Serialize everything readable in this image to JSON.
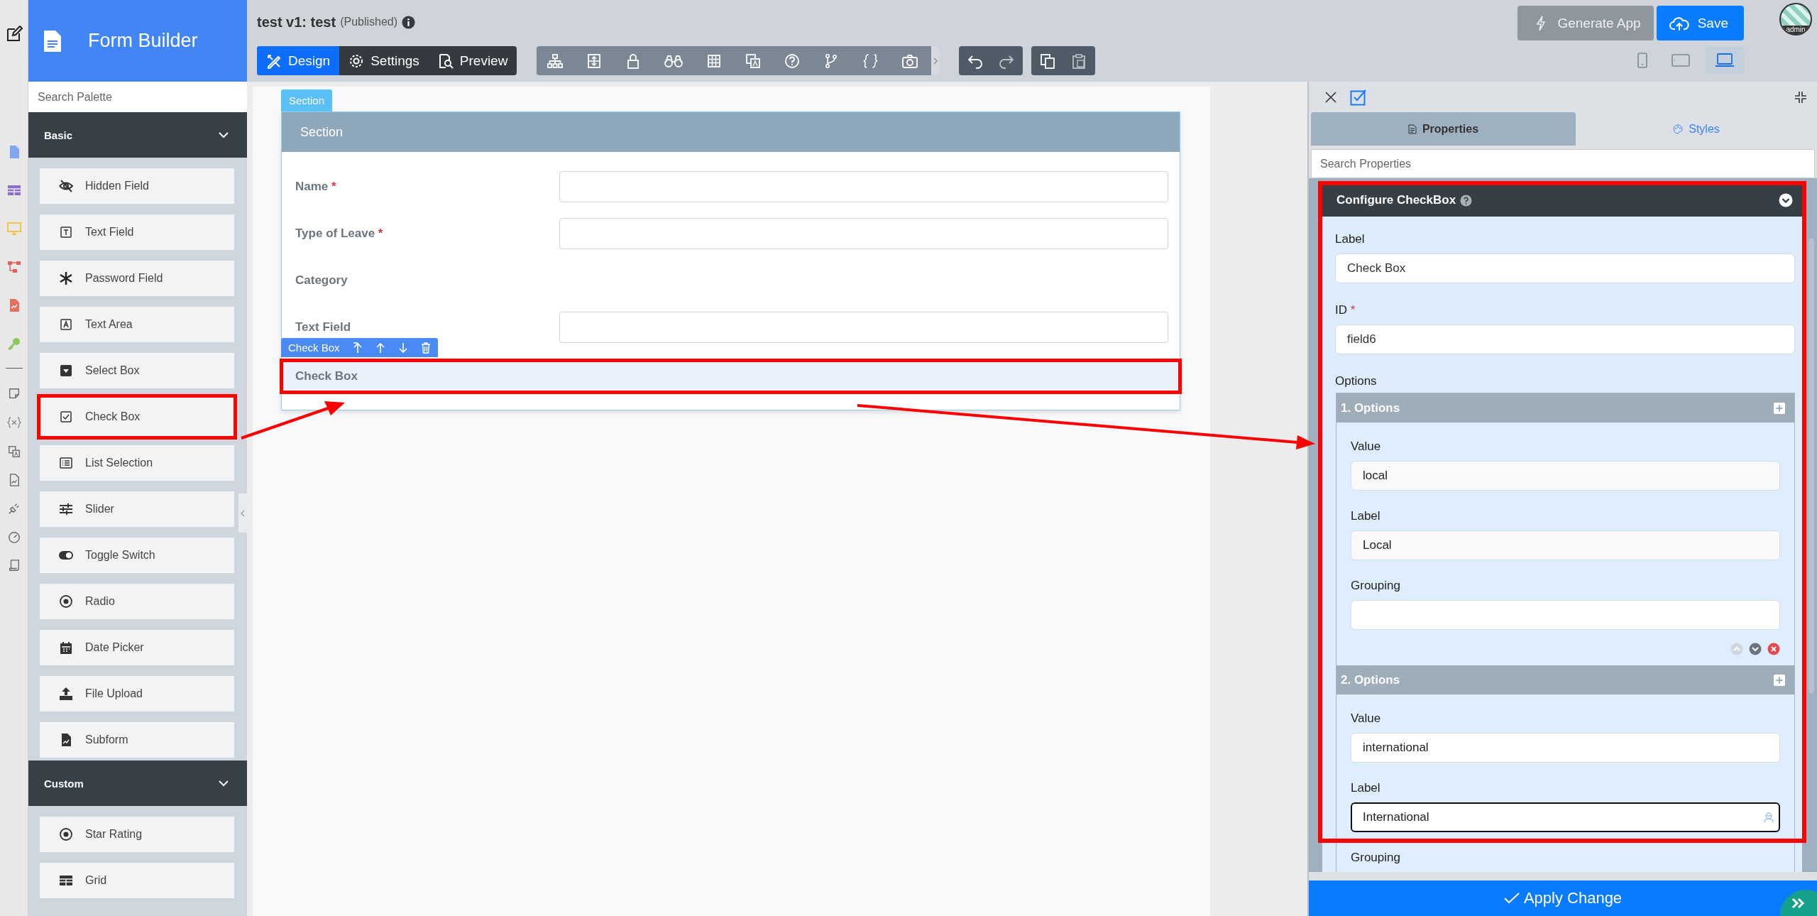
{
  "app": {
    "title": "Form Builder"
  },
  "document": {
    "name": "test v1: test",
    "status": "(Published)"
  },
  "mode_tabs": [
    {
      "label": "Design",
      "kind": "design",
      "selected": true
    },
    {
      "label": "Settings",
      "kind": "settings",
      "selected": false
    },
    {
      "label": "Preview",
      "kind": "preview",
      "selected": false
    }
  ],
  "actions": [
    {
      "label": "Generate App",
      "kind": "generate"
    },
    {
      "label": "Save",
      "kind": "save"
    }
  ],
  "user": {
    "name": "admin"
  },
  "devices": [
    {
      "kind": "phone",
      "selected": false
    },
    {
      "kind": "tablet",
      "selected": false
    },
    {
      "kind": "laptop",
      "selected": true
    }
  ],
  "palette": {
    "search_placeholder": "Search Palette",
    "groups": [
      {
        "title": "Basic",
        "expanded": true,
        "items": [
          {
            "label": "Hidden Field",
            "kind": "hidden",
            "highlighted": false
          },
          {
            "label": "Text Field",
            "kind": "text",
            "highlighted": false
          },
          {
            "label": "Password Field",
            "kind": "password",
            "highlighted": false
          },
          {
            "label": "Text Area",
            "kind": "textarea",
            "highlighted": false
          },
          {
            "label": "Select Box",
            "kind": "select",
            "highlighted": false
          },
          {
            "label": "Check Box",
            "kind": "checkbox",
            "highlighted": true
          },
          {
            "label": "List Selection",
            "kind": "list",
            "highlighted": false
          },
          {
            "label": "Slider",
            "kind": "slider",
            "highlighted": false
          },
          {
            "label": "Toggle Switch",
            "kind": "toggle",
            "highlighted": false
          },
          {
            "label": "Radio",
            "kind": "radio",
            "highlighted": false
          },
          {
            "label": "Date Picker",
            "kind": "date",
            "highlighted": false
          },
          {
            "label": "File Upload",
            "kind": "upload",
            "highlighted": false
          },
          {
            "label": "Subform",
            "kind": "subform",
            "highlighted": false
          }
        ]
      },
      {
        "title": "Custom",
        "expanded": true,
        "items": [
          {
            "label": "Star Rating",
            "kind": "radio",
            "highlighted": false
          },
          {
            "label": "Grid",
            "kind": "grid",
            "highlighted": false
          }
        ]
      }
    ]
  },
  "canvas": {
    "section_tab": "Section",
    "section_title": "Section",
    "toolbar_label": "Check Box",
    "fields": [
      {
        "label": "Name",
        "required_mark": "*",
        "kind": "input"
      },
      {
        "label": "Type of Leave",
        "required_mark": "*",
        "kind": "input"
      },
      {
        "label": "Category",
        "kind": "label"
      },
      {
        "label": "Text Field",
        "kind": "input"
      },
      {
        "label": "Check Box",
        "kind": "checkbox",
        "selected": true,
        "highlighted": true
      }
    ]
  },
  "inspector": {
    "tabs": [
      {
        "label": "Properties",
        "kind": "properties",
        "selected": true
      },
      {
        "label": "Styles",
        "kind": "styles",
        "selected": false
      }
    ],
    "search_placeholder": "Search Properties",
    "panel": {
      "title": "Configure CheckBox",
      "highlighted": true,
      "label_caption": "Label",
      "label_value": "Check Box",
      "id_caption": "ID",
      "id_required_mark": "*",
      "id_value": "field6",
      "options_caption": "Options",
      "options": [
        {
          "title": "1. Options",
          "value_caption": "Value",
          "value": "local",
          "label_caption": "Label",
          "label": "Local",
          "grouping_caption": "Grouping",
          "move_up_disabled": true,
          "focused": false
        },
        {
          "title": "2. Options",
          "value_caption": "Value",
          "value": "international",
          "label_caption": "Label",
          "label": "International",
          "grouping_caption": "Grouping",
          "focused": true
        }
      ]
    },
    "apply": "Apply Change"
  }
}
